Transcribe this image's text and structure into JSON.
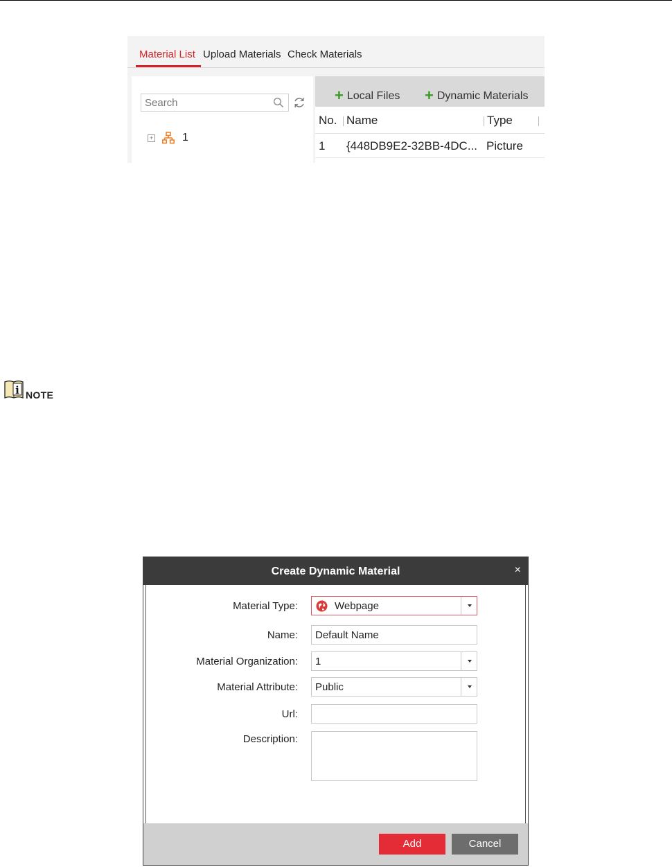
{
  "material_panel": {
    "tabs": [
      {
        "label": "Material List",
        "active": true
      },
      {
        "label": "Upload Materials",
        "active": false
      },
      {
        "label": "Check Materials",
        "active": false
      }
    ],
    "search": {
      "placeholder": "Search"
    },
    "tree": {
      "toggle": "+",
      "items": [
        {
          "label": "1"
        }
      ]
    },
    "toolbar": {
      "local_files_label": "Local Files",
      "dynamic_materials_label": "Dynamic Materials"
    },
    "table": {
      "columns": [
        "No.",
        "Name",
        "Type"
      ],
      "rows": [
        {
          "no": "1",
          "name": "{448DB9E2-32BB-4DC...",
          "type": "Picture"
        }
      ]
    }
  },
  "note": {
    "label": "NOTE"
  },
  "dialog": {
    "title": "Create Dynamic Material",
    "close_symbol": "×",
    "fields": {
      "material_type": {
        "label": "Material Type:",
        "value": "Webpage"
      },
      "name": {
        "label": "Name:",
        "value": "Default Name"
      },
      "organization": {
        "label": "Material Organization:",
        "value": "1"
      },
      "attribute": {
        "label": "Material Attribute:",
        "value": "Public"
      },
      "url": {
        "label": "Url:",
        "value": ""
      },
      "description": {
        "label": "Description:",
        "value": ""
      }
    },
    "buttons": {
      "add": "Add",
      "cancel": "Cancel"
    }
  },
  "colors": {
    "accent_red": "#d2232a",
    "add_button": "#e32c35",
    "cancel_button": "#6d6d6d",
    "plus_green": "#3a9a2a",
    "dialog_header": "#3b3b3b"
  }
}
